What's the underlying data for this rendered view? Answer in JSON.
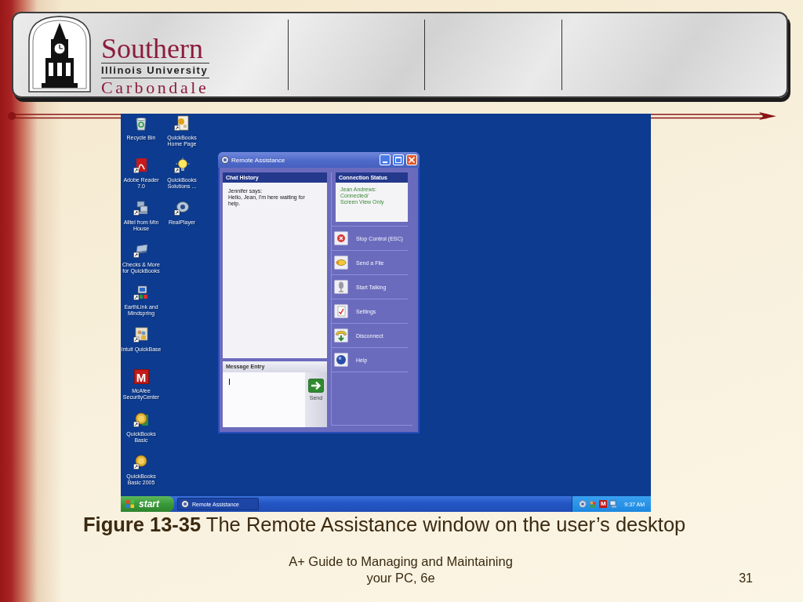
{
  "header": {
    "logo": {
      "title": "Southern",
      "subtitle": "Illinois University",
      "place": "Carbondale"
    }
  },
  "screenshot": {
    "desktop_icons": [
      {
        "label": "Recycle Bin"
      },
      {
        "label": "Adobe Reader 7.0"
      },
      {
        "label": "Alltel from Mtn House"
      },
      {
        "label": "Checks & More for QuickBooks"
      },
      {
        "label": "EarthLink and Mindspring"
      },
      {
        "label": "Intuit QuickBase"
      },
      {
        "label": "McAfee SecurityCenter",
        "glyph": "M"
      },
      {
        "label": "QuickBooks Basic"
      },
      {
        "label": "QuickBooks Basic 2005"
      },
      {
        "label": "QuickBooks Home Page"
      },
      {
        "label": "QuickBooks Solutions ..."
      },
      {
        "label": "RealPlayer"
      }
    ],
    "window": {
      "title": "Remote Assistance",
      "chat_history": {
        "heading": "Chat History",
        "sender": "Jennifer says:",
        "message": "Hello, Jean, I'm here waiting for help."
      },
      "message_entry": {
        "heading": "Message Entry",
        "send_button": "Send"
      },
      "connection_status": {
        "heading": "Connection Status",
        "text": "Jean Andrews:\nConnected/\nScreen View Only"
      },
      "actions": [
        {
          "label": "Stop Control (ESC)"
        },
        {
          "label": "Send a File"
        },
        {
          "label": "Start Talking"
        },
        {
          "label": "Settings"
        },
        {
          "label": "Disconnect"
        },
        {
          "label": "Help"
        }
      ]
    },
    "taskbar": {
      "start_button": "start",
      "tasks": [
        {
          "label": "Remote Assistance",
          "selected": true
        }
      ],
      "tray_glyph": "M",
      "clock": "9:37 AM"
    }
  },
  "caption": "**Figure 13-35** The Remote Assistance window on the user’s desktop",
  "footer": {
    "title": "A+ Guide to Managing and Maintaining your PC, 6e",
    "page_number": "31"
  }
}
